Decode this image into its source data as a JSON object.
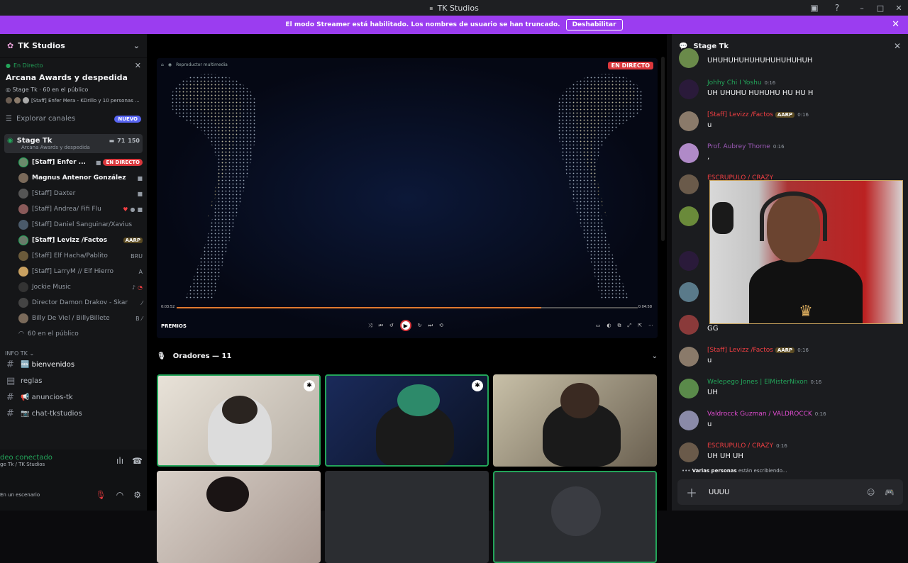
{
  "window": {
    "title": "TK Studios"
  },
  "banner": {
    "text": "El modo Streamer está habilitado. Los nombres de usuario se han truncado.",
    "button": "Deshabilitar"
  },
  "sidebar": {
    "server_name": "TK Studios",
    "live": {
      "status": "En Directo",
      "title": "Arcana Awards y despedida",
      "meta": "Stage Tk · 60 en el público",
      "people": "[Staff] Enfer Mera - KDrillo y 10 personas ..."
    },
    "explore": {
      "label": "Explorar canales",
      "badge": "NUEVO"
    },
    "stage": {
      "name": "Stage Tk",
      "subtitle": "Arcana Awards y despedida",
      "count_a": "71",
      "count_b": "150"
    },
    "members": [
      {
        "name": "[Staff] Enfer ...",
        "badge": "EN DIRECTO"
      },
      {
        "name": "Magnus Antenor González"
      },
      {
        "name": "[Staff] Daxter"
      },
      {
        "name": "[Staff] Andrea/ Fifi Flu"
      },
      {
        "name": "[Staff] Daniel Sanguinar/Xavius"
      },
      {
        "name": "[Staff] Levizz /Factos",
        "tag": "AARP"
      },
      {
        "name": "[Staff] Elf Hacha/Pablito",
        "tag": "BRU"
      },
      {
        "name": "[Staff] LarryM // Elf Hierro",
        "tag": "A"
      },
      {
        "name": "Jockie Music"
      },
      {
        "name": "Director Damon Drakov - Skar"
      },
      {
        "name": "Billy De Viel / BillyBillete",
        "tag": "B"
      }
    ],
    "audience": "60 en el público",
    "category": "INFO TK",
    "channels": [
      {
        "name": "🆕 bienvenidos"
      },
      {
        "name": "reglas"
      },
      {
        "name": "📢 anuncios-tk"
      },
      {
        "name": "📷 chat-tkstudios"
      }
    ],
    "voice": {
      "status": "deo conectado",
      "sub": "ge Tk / TK Studios"
    },
    "user": {
      "status": "En un escenario"
    }
  },
  "main": {
    "video": {
      "live_badge": "EN DIRECTO",
      "source": "Reproductor multimedia",
      "title": "PREMIOS",
      "time_start": "0:03:52",
      "time_end": "0:04:58",
      "progress": 0.79
    },
    "speakers_label": "Oradores — 11"
  },
  "chat": {
    "title": "Stage Tk",
    "messages": [
      {
        "name": "",
        "time": "",
        "text": "UHUHUHUHUHUHUHUHUHUH",
        "color": "#f2f3f5"
      },
      {
        "name": "Johhy Chi I Yoshu",
        "time": "0:16",
        "text": "UH UHUHU HUHUHU HU HU H",
        "color": "#23a55a"
      },
      {
        "name": "[Staff] Levizz /Factos",
        "tag": "AARP",
        "time": "0:16",
        "text": "u",
        "color": "#f23f43"
      },
      {
        "name": "Prof. Aubrey Thorne",
        "time": "0:16",
        "text": ",",
        "color": "#9b59b6"
      },
      {
        "name": "ESCRUPULO / CRAZY",
        "time": "0:16",
        "text": "",
        "color": "#f23f43"
      },
      {
        "name": "",
        "time": "",
        "text": "GG",
        "color": "#f2f3f5"
      },
      {
        "name": "[Staff] Levizz /Factos",
        "tag": "AARP",
        "time": "0:16",
        "text": "u",
        "color": "#f23f43"
      },
      {
        "name": "Welepego Jones | ElMisterNixon",
        "time": "0:16",
        "text": "UH",
        "color": "#23a55a"
      },
      {
        "name": "Valdrocck Guzman / VALDROCCK",
        "time": "0:16",
        "text": "u",
        "color": "#e04cd0"
      },
      {
        "name": "ESCRUPULO / CRAZY",
        "time": "0:16",
        "text": "UH UH UH",
        "color": "#f23f43"
      }
    ],
    "typing_who": "Varias personas",
    "typing_rest": "están escribiendo...",
    "input_value": "UUUU"
  }
}
